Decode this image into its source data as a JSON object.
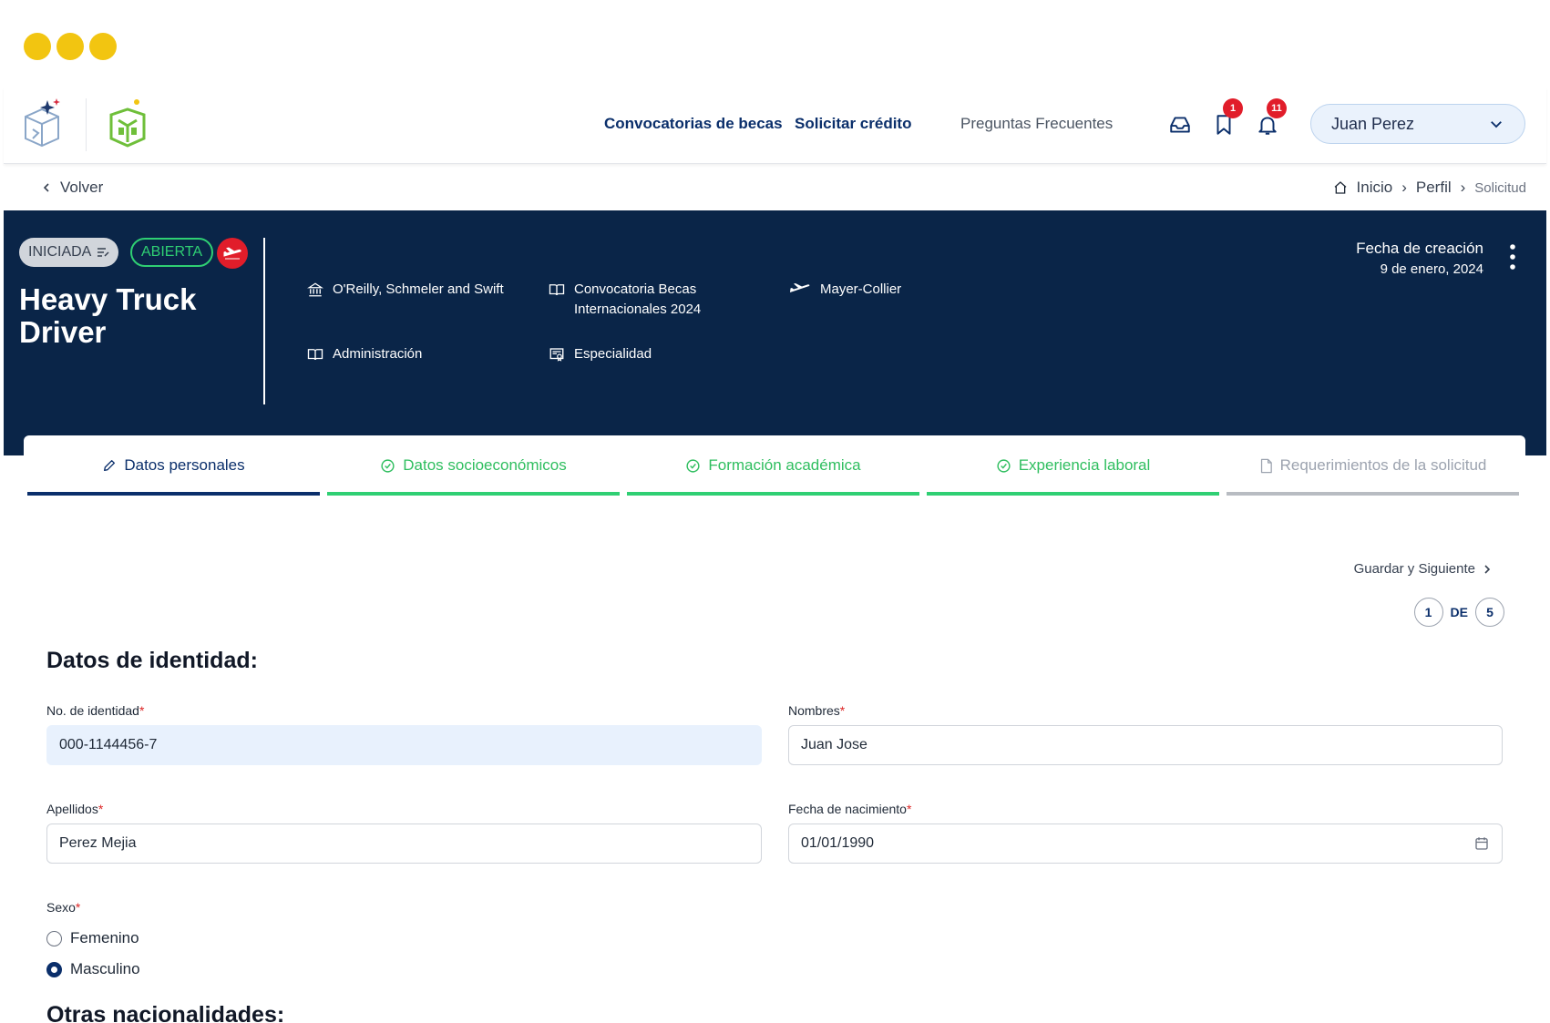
{
  "nav": {
    "links": [
      "Convocatorias de becas",
      "Solicitar crédito",
      "Preguntas Frecuentes"
    ],
    "bookmark_count": "1",
    "notification_count": "11",
    "user_name": "Juan Perez"
  },
  "subbar": {
    "back_label": "Volver",
    "breadcrumb": [
      "Inicio",
      "Perfil",
      "Solicitud"
    ]
  },
  "banner": {
    "status_started": "INICIADA",
    "status_open": "ABIERTA",
    "title": "Heavy Truck Driver",
    "institution": "O'Reilly, Schmeler and Swift",
    "call": "Convocatoria Becas Internacionales 2024",
    "company": "Mayer-Collier",
    "area": "Administración",
    "level": "Especialidad",
    "created_label": "Fecha de creación",
    "created_value": "9 de enero, 2024"
  },
  "tabs": [
    {
      "label": "Datos personales",
      "state": "active"
    },
    {
      "label": "Datos socioeconómicos",
      "state": "done"
    },
    {
      "label": "Formación académica",
      "state": "done"
    },
    {
      "label": "Experiencia laboral",
      "state": "done"
    },
    {
      "label": "Requerimientos de la solicitud",
      "state": "pending"
    }
  ],
  "form": {
    "save_next": "Guardar y Siguiente",
    "page_current": "1",
    "page_of": "DE",
    "page_total": "5",
    "section_identity": "Datos de identidad:",
    "id_label": "No. de identidad",
    "id_value": "000-1144456-7",
    "names_label": "Nombres",
    "names_value": "Juan Jose",
    "surnames_label": "Apellidos",
    "surnames_value": "Perez Mejia",
    "dob_label": "Fecha de nacimiento",
    "dob_value": "01/01/1990",
    "sex_label": "Sexo",
    "sex_options": [
      "Femenino",
      "Masculino"
    ],
    "sex_selected": "Masculino",
    "section_other": "Otras nacionalidades:"
  },
  "colors": {
    "navy": "#0a2548",
    "accent_green": "#2fcf73",
    "alert_red": "#e11d2a",
    "dots_yellow": "#f2c511"
  }
}
